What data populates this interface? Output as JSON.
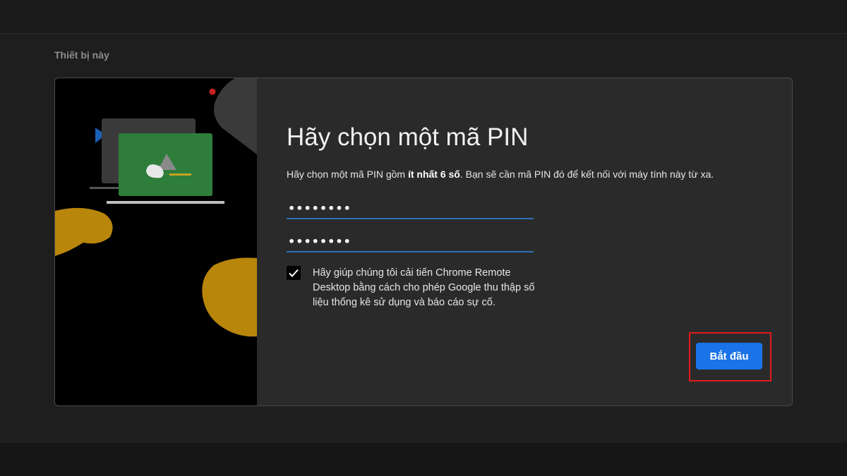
{
  "section": {
    "title": "Thiết bị này"
  },
  "pin_setup": {
    "heading": "Hãy chọn một mã PIN",
    "description_before": "Hãy chọn một mã PIN gồm ",
    "description_bold": "ít nhất 6 số",
    "description_after": ". Bạn sẽ cần mã PIN đó để kết nối với máy tính này từ xa.",
    "pin_value": "••••••••",
    "pin_confirm_value": "••••••••",
    "consent_checked": true,
    "consent_text": "Hãy giúp chúng tôi cải tiến Chrome Remote Desktop bằng cách cho phép Google thu thập số liệu thống kê sử dụng và báo cáo sự cố.",
    "start_label": "Bắt đầu"
  },
  "icons": {
    "checkbox": "checkmark-icon"
  },
  "colors": {
    "accent": "#1a73e8",
    "input_underline": "#2f6fb8",
    "highlight": "#e21b1b",
    "illustration_screen": "#2e7d3b",
    "illustration_blob": "#b8860b"
  }
}
